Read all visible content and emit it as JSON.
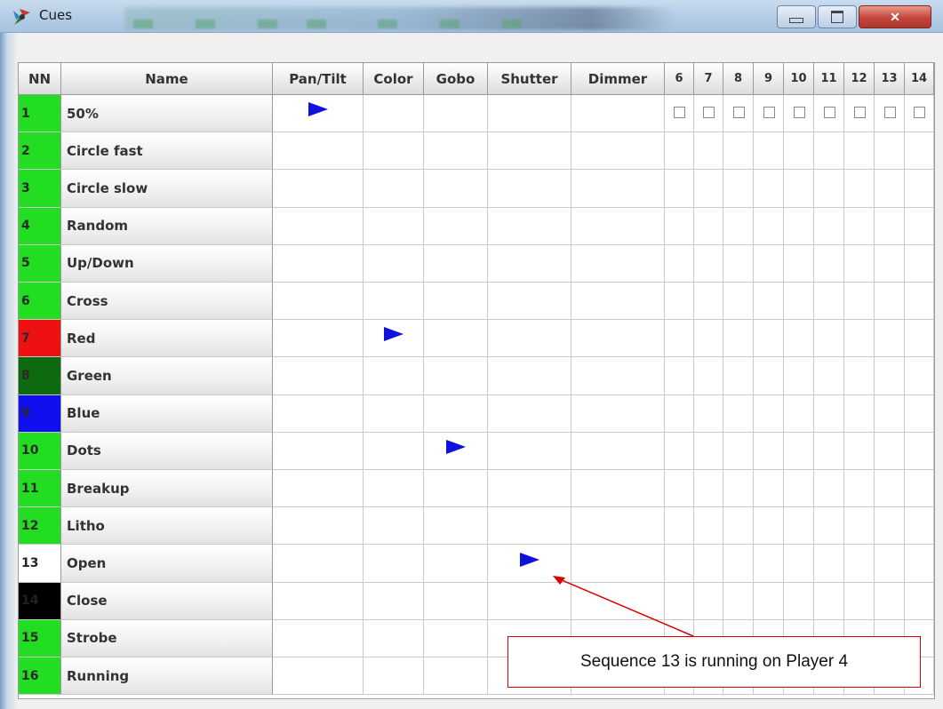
{
  "window": {
    "title": "Cues",
    "controls": [
      "minimize-icon",
      "maximize-icon",
      "close-icon"
    ]
  },
  "table": {
    "headers": [
      "NN",
      "Name",
      "Pan/Tilt",
      "Color",
      "Gobo",
      "Shutter",
      "Dimmer",
      "6",
      "7",
      "8",
      "9",
      "10",
      "11",
      "12",
      "13",
      "14"
    ],
    "rows": [
      {
        "nn": "1",
        "name": "50%",
        "color": "#22dd22"
      },
      {
        "nn": "2",
        "name": "Circle fast",
        "color": "#22dd22"
      },
      {
        "nn": "3",
        "name": "Circle slow",
        "color": "#22dd22"
      },
      {
        "nn": "4",
        "name": "Random",
        "color": "#22dd22"
      },
      {
        "nn": "5",
        "name": "Up/Down",
        "color": "#22dd22"
      },
      {
        "nn": "6",
        "name": "Cross",
        "color": "#22dd22"
      },
      {
        "nn": "7",
        "name": "Red",
        "color": "#ee1111"
      },
      {
        "nn": "8",
        "name": "Green",
        "color": "#0e6a0e"
      },
      {
        "nn": "9",
        "name": "Blue",
        "color": "#1010ee"
      },
      {
        "nn": "10",
        "name": "Dots",
        "color": "#22dd22"
      },
      {
        "nn": "11",
        "name": "Breakup",
        "color": "#22dd22"
      },
      {
        "nn": "12",
        "name": "Litho",
        "color": "#22dd22"
      },
      {
        "nn": "13",
        "name": "Open",
        "color": "#ffffff"
      },
      {
        "nn": "14",
        "name": "Close",
        "color": "#000000"
      },
      {
        "nn": "15",
        "name": "Strobe",
        "color": "#22dd22"
      },
      {
        "nn": "16",
        "name": "Running",
        "color": "#22dd22"
      }
    ],
    "playing": [
      {
        "row": 0,
        "col": 2
      },
      {
        "row": 6,
        "col": 3
      },
      {
        "row": 9,
        "col": 4
      },
      {
        "row": 12,
        "col": 5
      }
    ],
    "checkbox_row": 0
  },
  "annotation": {
    "text": "Sequence 13 is running on Player 4",
    "color": "#d80000"
  }
}
